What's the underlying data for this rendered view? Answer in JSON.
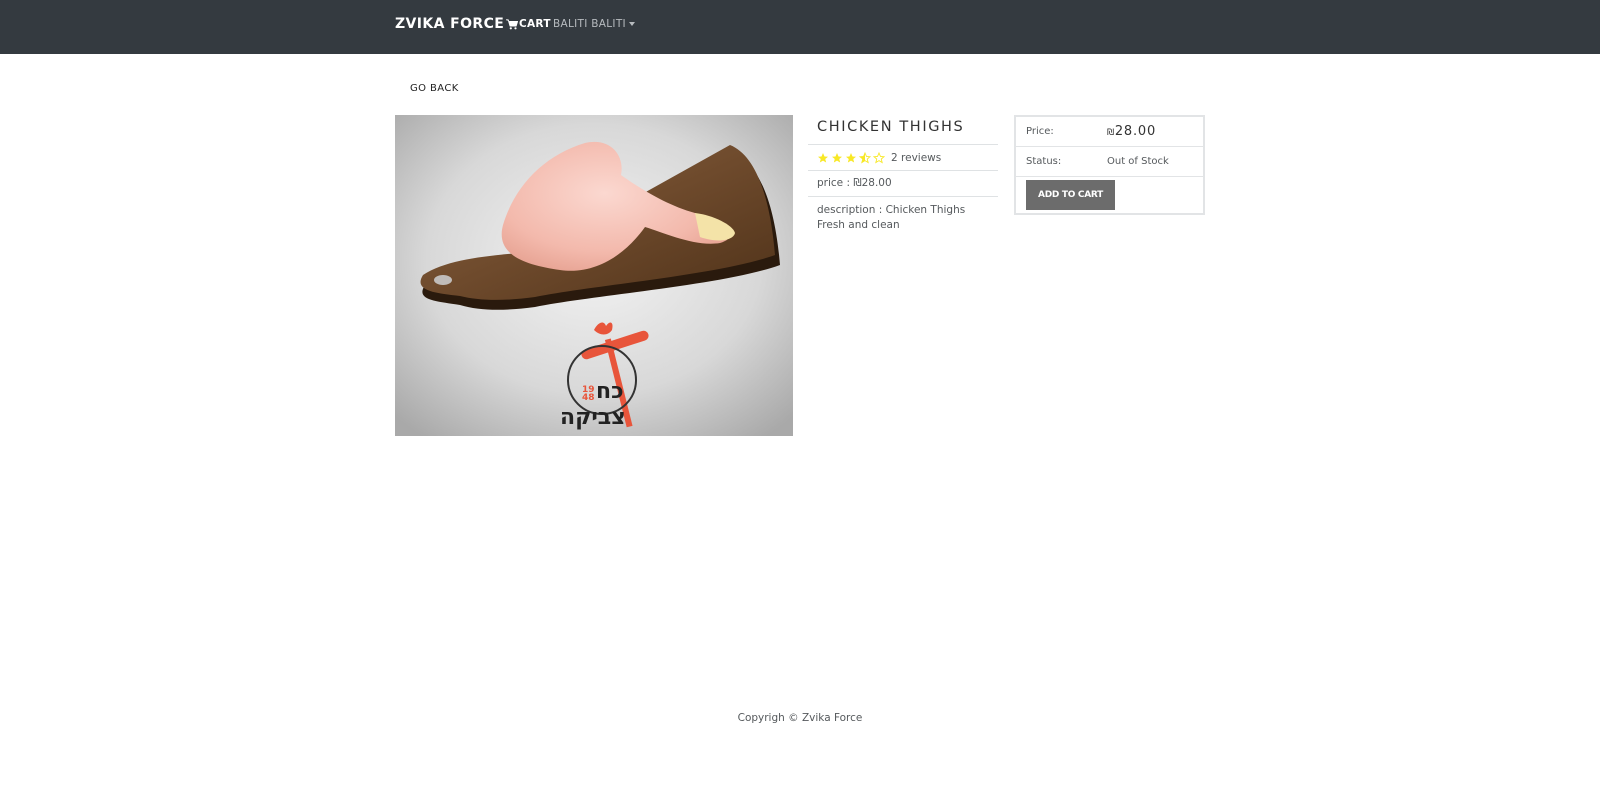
{
  "navbar": {
    "brand": "ZVIKA FORCE",
    "cart_label": "CART",
    "user_label": "BALITI BALITI",
    "icons": {
      "cart": "cart-icon",
      "dropdown": "caret-down-icon"
    }
  },
  "go_back_label": "GO BACK",
  "product": {
    "name": "CHICKEN THIGHS",
    "rating": 3.5,
    "rating_max": 5,
    "reviews_text": "2 reviews",
    "price_line": "price : ₪28.00",
    "description_line1": "description : Chicken Thighs",
    "description_line2": "Fresh and clean",
    "image_logo_text": "כח צביקה",
    "image_logo_year": "19 48"
  },
  "buy_box": {
    "price_label": "Price:",
    "price_currency": "₪",
    "price_value": "28.00",
    "status_label": "Status:",
    "status_value": "Out of Stock",
    "add_to_cart_label": "ADD TO CART"
  },
  "footer": {
    "text": "Copyrigh © Zvika Force"
  },
  "colors": {
    "navbar": "#343a40",
    "star": "#f8e825",
    "button": "#6c6c6c"
  }
}
